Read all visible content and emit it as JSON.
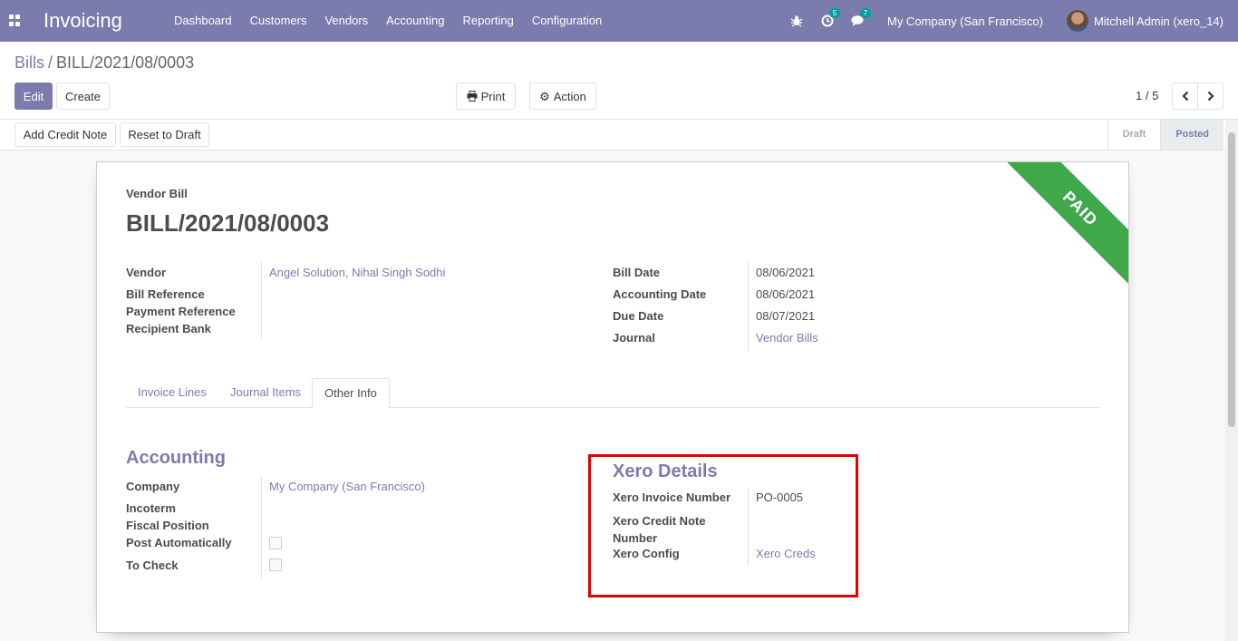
{
  "navbar": {
    "app_name": "Invoicing",
    "menu": [
      "Dashboard",
      "Customers",
      "Vendors",
      "Accounting",
      "Reporting",
      "Configuration"
    ],
    "activity_count": "5",
    "message_count": "7",
    "company": "My Company (San Francisco)",
    "user": "Mitchell Admin (xero_14)"
  },
  "breadcrumb": {
    "parent": "Bills",
    "separator": "/",
    "current": "BILL/2021/08/0003"
  },
  "buttons": {
    "edit": "Edit",
    "create": "Create",
    "print": "Print",
    "action": "Action",
    "add_credit_note": "Add Credit Note",
    "reset_to_draft": "Reset to Draft"
  },
  "pager": {
    "value": "1 / 5"
  },
  "status": {
    "steps": [
      "Draft",
      "Posted"
    ],
    "current": "Posted"
  },
  "ribbon": "PAID",
  "document": {
    "kind": "Vendor Bill",
    "name": "BILL/2021/08/0003",
    "left_fields": [
      {
        "label": "Vendor",
        "value": "Angel Solution, Nihal Singh Sodhi"
      },
      {
        "label": "Bill Reference",
        "value": ""
      },
      {
        "label": "Payment Reference",
        "value": ""
      },
      {
        "label": "Recipient Bank",
        "value": ""
      }
    ],
    "right_fields": [
      {
        "label": "Bill Date",
        "value": "08/06/2021"
      },
      {
        "label": "Accounting Date",
        "value": "08/06/2021"
      },
      {
        "label": "Due Date",
        "value": "08/07/2021"
      },
      {
        "label": "Journal",
        "value": "Vendor Bills"
      }
    ]
  },
  "tabs": [
    "Invoice Lines",
    "Journal Items",
    "Other Info"
  ],
  "active_tab": "Other Info",
  "accounting": {
    "title": "Accounting",
    "fields": [
      {
        "label": "Company",
        "value": "My Company (San Francisco)"
      },
      {
        "label": "Incoterm",
        "value": ""
      },
      {
        "label": "Fiscal Position",
        "value": ""
      },
      {
        "label": "Post Automatically",
        "checked": false
      },
      {
        "label": "To Check",
        "checked": false
      }
    ]
  },
  "xero": {
    "title": "Xero Details",
    "fields": [
      {
        "label": "Xero Invoice Number",
        "value": "PO-0005"
      },
      {
        "label": "Xero Credit Note Number",
        "label_line1": "Xero Credit Note",
        "label_line2": "Number",
        "value": ""
      },
      {
        "label": "Xero Config",
        "value": "Xero Creds"
      }
    ]
  },
  "colors": {
    "brand": "#7c7bad",
    "paid_ribbon": "#3ea84b",
    "highlight": "#e40000",
    "badge": "#00a09d"
  },
  "icons": {
    "apps": "apps-grid-icon",
    "bug": "bug-icon",
    "activity": "clock-icon",
    "messages": "chat-icon",
    "print": "printer-icon",
    "action": "gear-icon",
    "prev": "chevron-left-icon",
    "next": "chevron-right-icon"
  }
}
